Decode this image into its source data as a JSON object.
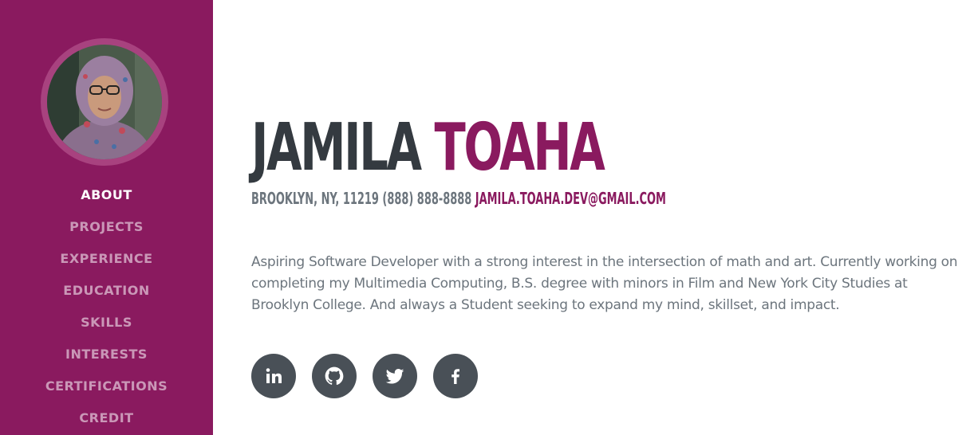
{
  "sidebar": {
    "avatar_alt": "Profile photo",
    "nav_items": [
      {
        "label": "ABOUT",
        "active": true
      },
      {
        "label": "PROJECTS",
        "active": false
      },
      {
        "label": "EXPERIENCE",
        "active": false
      },
      {
        "label": "EDUCATION",
        "active": false
      },
      {
        "label": "SKILLS",
        "active": false
      },
      {
        "label": "INTERESTS",
        "active": false
      },
      {
        "label": "CERTIFICATIONS",
        "active": false
      },
      {
        "label": "CREDIT",
        "active": false
      }
    ]
  },
  "about": {
    "first_name": "JAMILA",
    "last_name": "TOAHA",
    "address_phone": "BROOKLYN, NY, 11219 (888) 888-8888",
    "email": "JAMILA.TOAHA.DEV@GMAIL.COM",
    "lead": "Aspiring Software Developer with a strong interest in the intersection of math and art. Currently working on completing my Multimedia Computing, B.S. degree with minors in Film and New York City Studies at Brooklyn College. And always a Student seeking to expand my mind, skillset, and impact."
  },
  "social": [
    {
      "name": "linkedin-icon"
    },
    {
      "name": "github-icon"
    },
    {
      "name": "twitter-icon"
    },
    {
      "name": "facebook-icon"
    }
  ],
  "colors": {
    "primary": "#8a1a5f",
    "dark": "#343a40",
    "muted": "#6c757d",
    "icon_bg": "#495057"
  }
}
